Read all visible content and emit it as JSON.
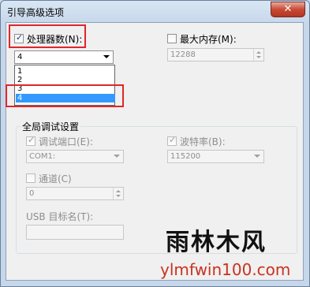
{
  "window": {
    "title": "引导高级选项",
    "close_label": "✕"
  },
  "processors": {
    "label": "处理器数(N):",
    "checked": true,
    "combo_value": "4",
    "options": [
      "1",
      "2",
      "3",
      "4"
    ],
    "selected_index": 3
  },
  "max_memory": {
    "label": "最大内存(M):",
    "checked": false,
    "value": "12288"
  },
  "global_debug": {
    "title": "全局调试设置",
    "debug_port": {
      "label": "调试端口(E):",
      "checked": true,
      "value": "COM1:"
    },
    "baud_rate": {
      "label": "波特率(B):",
      "checked": true,
      "value": "115200"
    },
    "channel": {
      "label": "通道(C)",
      "checked": false,
      "value": "0"
    },
    "usb_target": {
      "label": "USB 目标名(T):",
      "value": ""
    }
  },
  "watermark": {
    "brand_cn": "雨林木风",
    "brand_url": "ylmfwin100.com"
  },
  "colors": {
    "highlight": "#e0262b",
    "selection": "#3399ff"
  }
}
